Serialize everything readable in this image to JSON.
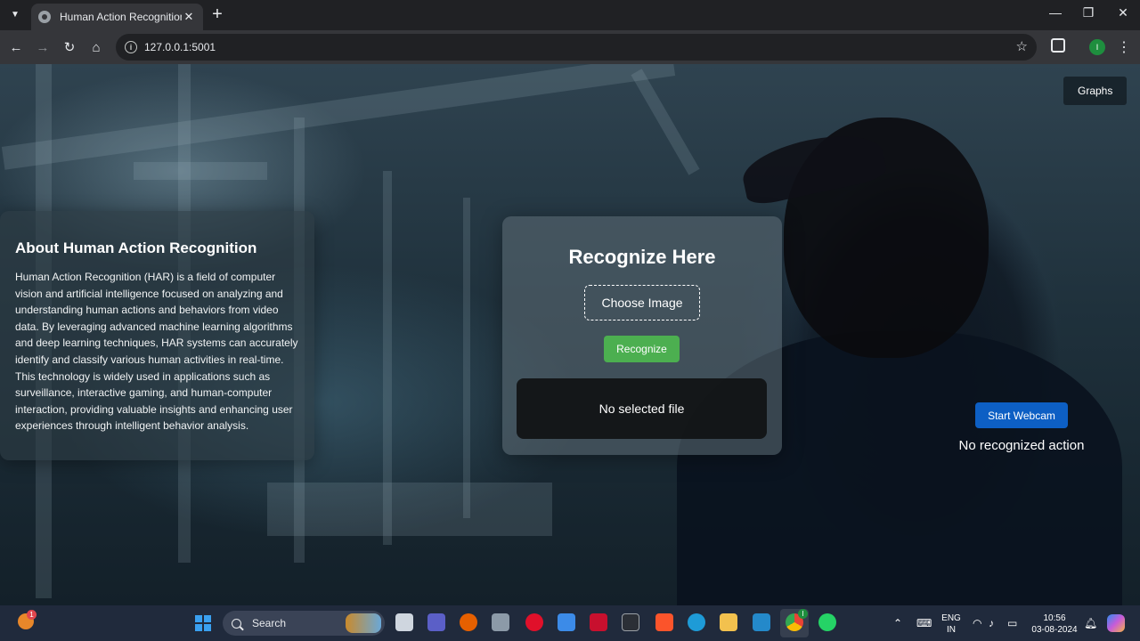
{
  "browser": {
    "tab_title": "Human Action Recognition",
    "url": "127.0.0.1:5001",
    "profile_initial": "I"
  },
  "page": {
    "nav": {
      "graphs_label": "Graphs"
    },
    "about": {
      "title": "About Human Action Recognition",
      "text": "Human Action Recognition (HAR) is a field of computer vision and artificial intelligence focused on analyzing and understanding human actions and behaviors from video data. By leveraging advanced machine learning algorithms and deep learning techniques, HAR systems can accurately identify and classify various human activities in real-time. This technology is widely used in applications such as surveillance, interactive gaming, and human-computer interaction, providing valuable insights and enhancing user experiences through intelligent behavior analysis."
    },
    "recognize": {
      "title": "Recognize Here",
      "choose_label": "Choose Image",
      "recognize_label": "Recognize",
      "result_text": "No selected file"
    },
    "webcam": {
      "button_label": "Start Webcam",
      "status_text": "No recognized action"
    },
    "colors": {
      "recognize_button": "#4caf50",
      "webcam_button": "#0d5fc4"
    }
  },
  "taskbar": {
    "weather_badge": "1",
    "search_label": "Search",
    "chrome_badge": "I",
    "lang_line1": "ENG",
    "lang_line2": "IN",
    "time": "10:56",
    "date": "03-08-2024"
  }
}
